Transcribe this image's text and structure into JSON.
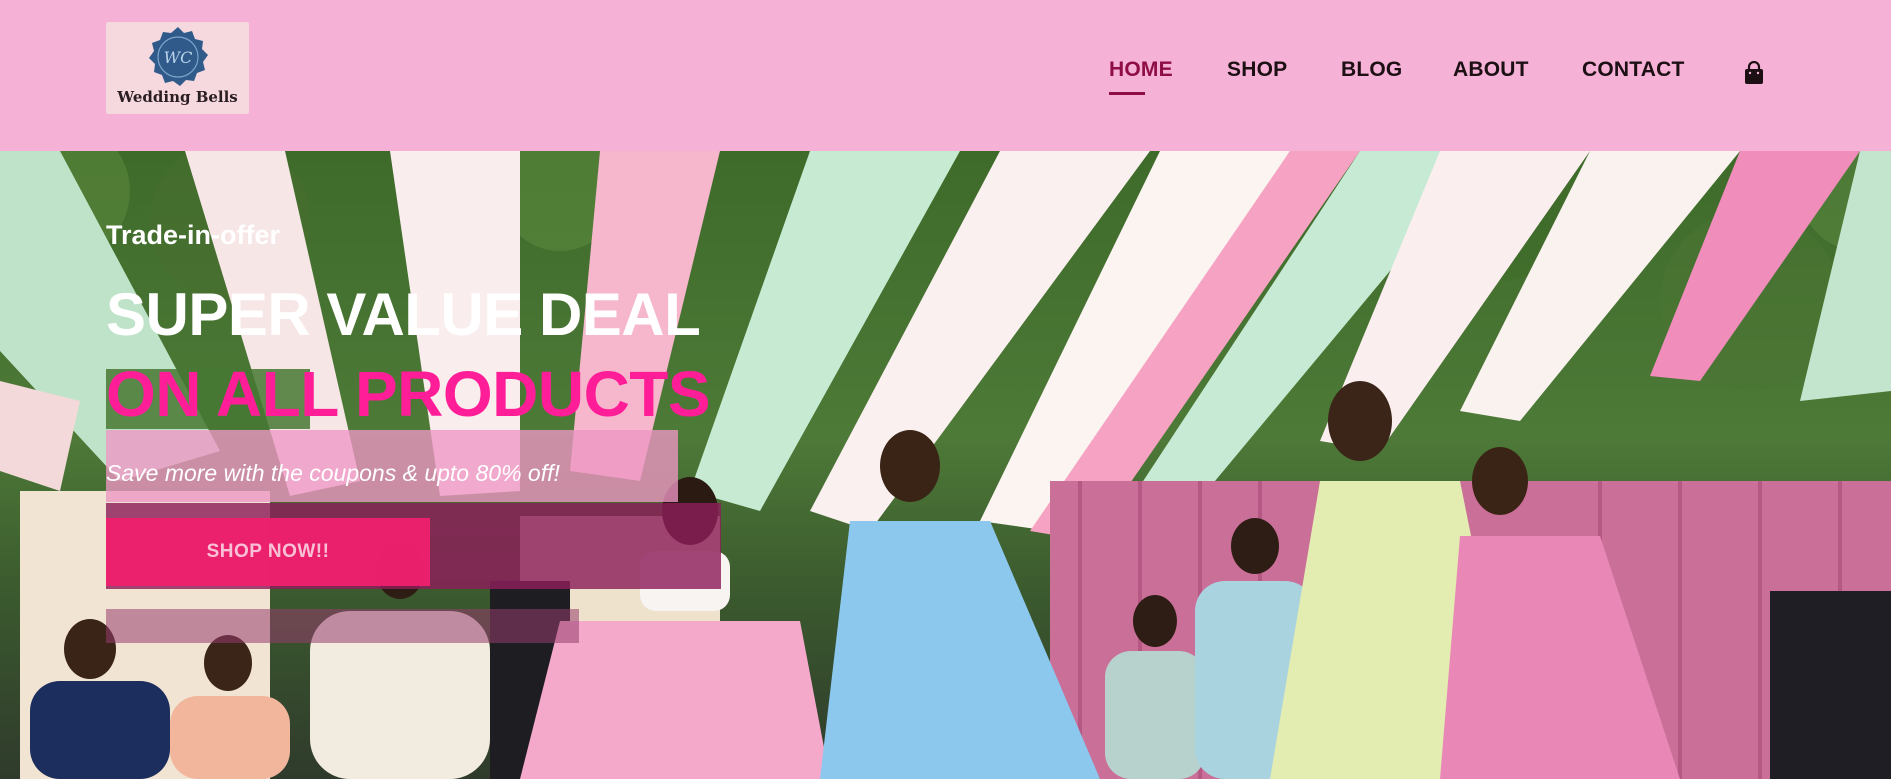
{
  "header": {
    "logo": {
      "brand": "Wedding Bells",
      "monogram": "WC",
      "icon": "wax-seal-icon"
    },
    "nav": {
      "items": [
        {
          "label": "HOME",
          "active": true
        },
        {
          "label": "SHOP",
          "active": false
        },
        {
          "label": "BLOG",
          "active": false
        },
        {
          "label": "ABOUT",
          "active": false
        },
        {
          "label": "CONTACT",
          "active": false
        }
      ],
      "cart_icon": "shopping-bag-icon"
    },
    "colors": {
      "background": "#f6b1d6",
      "active_link": "#8e0d45",
      "link": "#1c1014"
    }
  },
  "hero": {
    "promo_tag": "Trade-in-offer",
    "headline": "SUPER VALUE DEAL",
    "subheadline": "ON ALL PRODUCTS",
    "tagline": "Save more with the coupons & upto 80% off!",
    "cta_label": "SHOP NOW!!",
    "colors": {
      "subheadline": "#ff1e97",
      "cta": "#f0206e"
    }
  }
}
